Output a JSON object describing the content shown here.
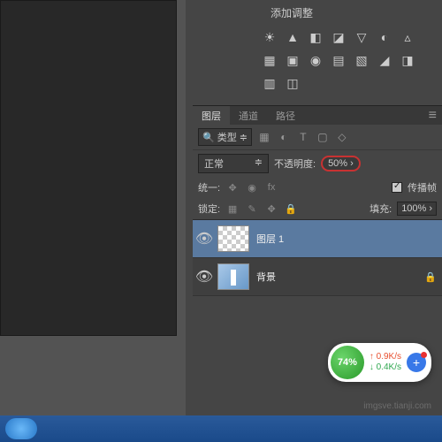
{
  "adjustments": {
    "title": "添加调整",
    "icons": [
      "☀",
      "▲",
      "◧",
      "◪",
      "▽",
      "◐",
      "▵",
      "▦",
      "▣",
      "◉",
      "▤",
      "▧",
      "◢",
      "◨",
      "▥",
      "◫"
    ]
  },
  "tabs": [
    {
      "label": "图层",
      "active": true
    },
    {
      "label": "通道",
      "active": false
    },
    {
      "label": "路径",
      "active": false
    }
  ],
  "filter": {
    "type_label": "类型",
    "icons": [
      "▦",
      "◐",
      "T",
      "▢",
      "◇"
    ]
  },
  "blend": {
    "mode": "正常",
    "opacity_label": "不透明度:",
    "opacity_value": "50%"
  },
  "unify": {
    "label": "统一:",
    "propagate_label": "传播帧"
  },
  "lock": {
    "label": "锁定:",
    "fill_label": "填充:",
    "fill_value": "100%"
  },
  "layers": [
    {
      "name": "图层 1",
      "selected": true,
      "locked": false,
      "thumb": "checker"
    },
    {
      "name": "背景",
      "selected": false,
      "locked": true,
      "thumb": "bg"
    }
  ],
  "speed": {
    "percent": "74%",
    "up": "0.9K/s",
    "down": "0.4K/s"
  },
  "watermark": "imgsve.tianji.com"
}
